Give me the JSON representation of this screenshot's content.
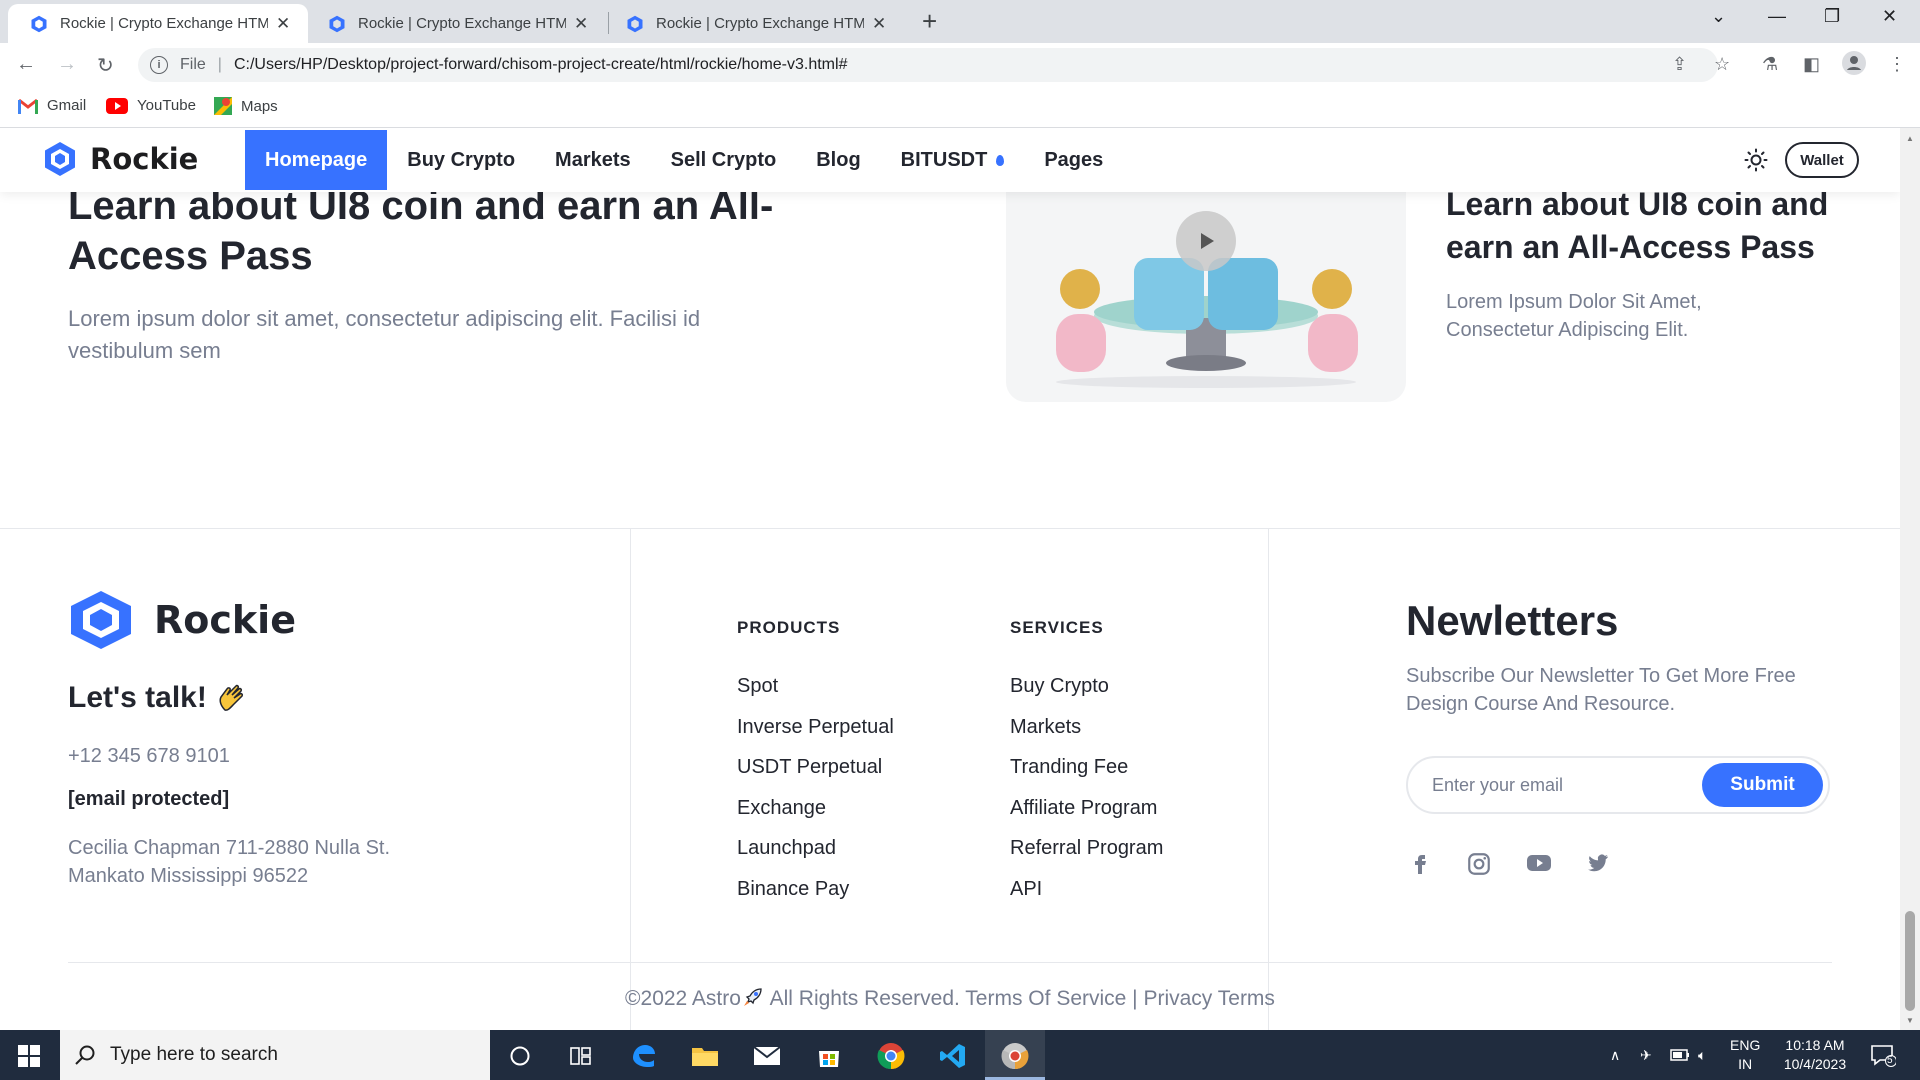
{
  "browser": {
    "tabs": [
      {
        "title": "Rockie | Crypto Exchange HTML"
      },
      {
        "title": "Rockie | Crypto Exchange HTML"
      },
      {
        "title": "Rockie | Crypto Exchange HTML"
      }
    ],
    "address": {
      "scheme": "File",
      "url": "C:/Users/HP/Desktop/project-forward/chisom-project-create/html/rockie/home-v3.html#"
    },
    "bookmarks": [
      {
        "label": "Gmail",
        "icon": "gmail-icon"
      },
      {
        "label": "YouTube",
        "icon": "youtube-icon"
      },
      {
        "label": "Maps",
        "icon": "maps-icon"
      }
    ]
  },
  "header": {
    "brand": "Rockie",
    "nav": [
      "Homepage",
      "Buy Crypto",
      "Markets",
      "Sell Crypto",
      "Blog",
      "BITUSDT",
      "Pages"
    ],
    "active_nav": "Homepage",
    "wallet_label": "Wallet"
  },
  "hero": {
    "title": "Learn about UI8 coin and earn an All-Access Pass",
    "description": "Lorem ipsum dolor sit amet, consectetur adipiscing elit. Facilisi id vestibulum sem"
  },
  "video_card": {
    "title": "Learn about UI8 coin and earn an All-Access Pass",
    "description": "Lorem Ipsum Dolor Sit Amet, Consectetur Adipiscing Elit."
  },
  "footer": {
    "brand": "Rockie",
    "talk": "Let's talk!",
    "phone": "+12 345 678 9101",
    "email": "[email protected]",
    "address": "Cecilia Chapman 711-2880 Nulla St. Mankato Mississippi 96522",
    "products": {
      "heading": "PRODUCTS",
      "items": [
        "Spot",
        "Inverse Perpetual",
        "USDT Perpetual",
        "Exchange",
        "Launchpad",
        "Binance Pay"
      ]
    },
    "services": {
      "heading": "SERVICES",
      "items": [
        "Buy Crypto",
        "Markets",
        "Tranding Fee",
        "Affiliate Program",
        "Referral Program",
        "API"
      ]
    },
    "newsletter": {
      "title": "Newletters",
      "description": "Subscribe Our Newsletter To Get More Free Design Course And Resource.",
      "placeholder": "Enter your email",
      "submit_label": "Submit"
    },
    "social": [
      "facebook-icon",
      "instagram-icon",
      "youtube-icon",
      "twitter-icon"
    ],
    "copyright_prefix": "©2022 Astro",
    "copyright_suffix": " All Rights Reserved. Terms Of Service | Privacy Terms"
  },
  "taskbar": {
    "search_placeholder": "Type here to search",
    "lang_top": "ENG",
    "lang_bottom": "IN",
    "time": "10:18 AM",
    "date": "10/4/2023",
    "notifications": "5"
  },
  "colors": {
    "accent": "#3772ff",
    "text": "#23262f",
    "muted": "#777e90"
  }
}
